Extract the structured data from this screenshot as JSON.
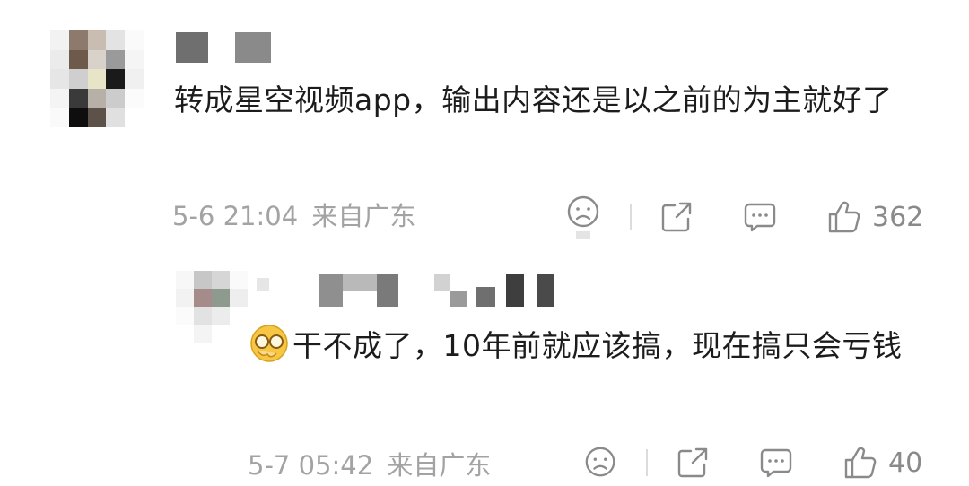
{
  "comments": [
    {
      "text": "转成星空视频app，输出内容还是以之前的为主就好了",
      "time": "5-6 21:04",
      "location": "来自广东",
      "likes": "362"
    },
    {
      "text": "干不成了，10年前就应该搞，现在搞只会亏钱",
      "time": "5-7 05:42",
      "location": "来自广东",
      "likes": "40"
    }
  ],
  "icons": {
    "dislike": "sad-face-icon",
    "share": "share-icon",
    "reply": "comment-icon",
    "like": "thumbs-up-icon",
    "reaction_emoji": "facepalm-emoji-icon"
  },
  "colors": {
    "text": "#1c1c1c",
    "meta": "#a3a3a3",
    "icon": "#8a8a8a"
  }
}
